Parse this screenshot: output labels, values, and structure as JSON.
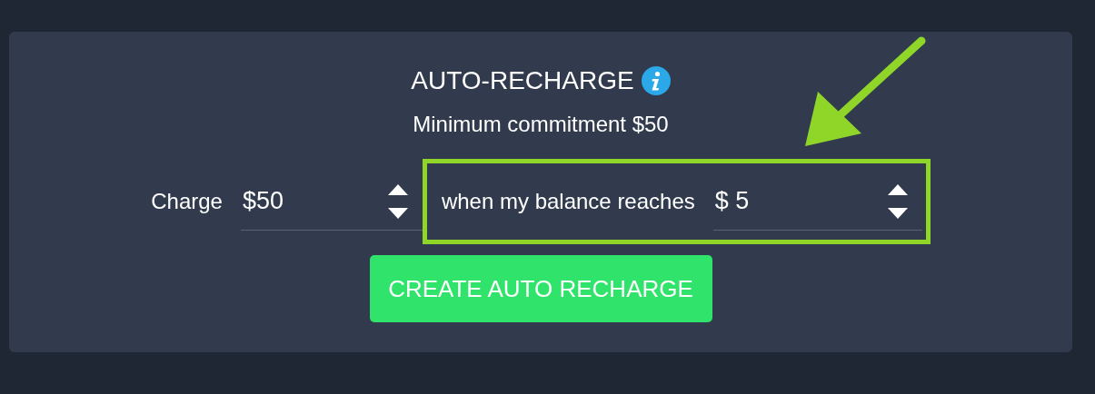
{
  "title": "AUTO-RECHARGE",
  "subtitle": "Minimum commitment $50",
  "charge": {
    "label": "Charge",
    "value": "$50"
  },
  "threshold": {
    "label": "when my balance reaches",
    "value": "$ 5",
    "highlighted": true
  },
  "button": "CREATE AUTO RECHARGE"
}
